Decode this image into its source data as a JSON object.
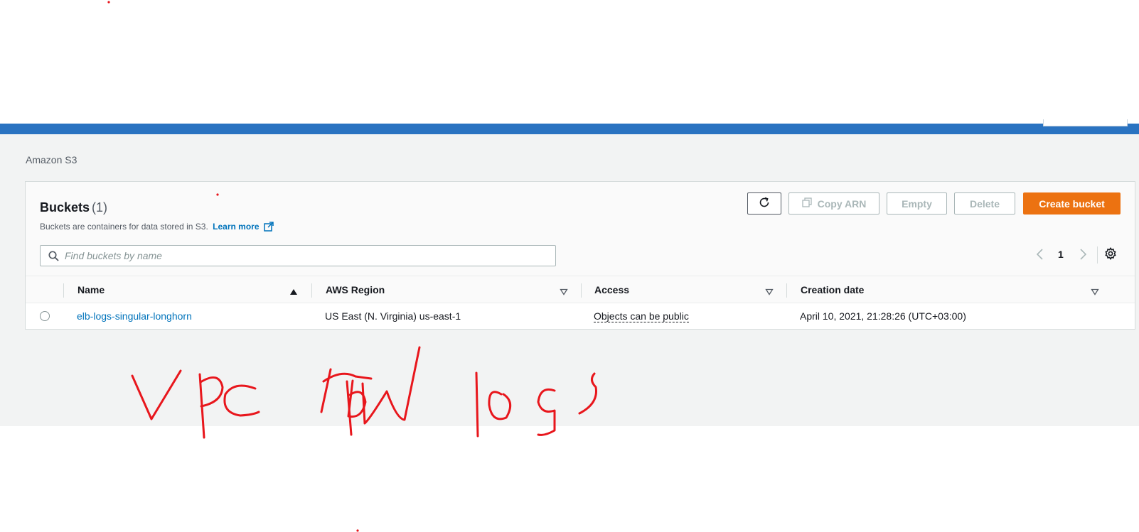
{
  "breadcrumb": "Amazon S3",
  "panel": {
    "title": "Buckets",
    "count": "(1)",
    "description": "Buckets are containers for data stored in S3.",
    "learn_more": "Learn more"
  },
  "actions": {
    "refresh_icon": "refresh-icon",
    "copy_arn": "Copy ARN",
    "empty": "Empty",
    "delete": "Delete",
    "create_bucket": "Create bucket"
  },
  "search": {
    "placeholder": "Find buckets by name",
    "value": ""
  },
  "pagination": {
    "current_page": "1"
  },
  "table": {
    "columns": [
      "Name",
      "AWS Region",
      "Access",
      "Creation date"
    ],
    "rows": [
      {
        "name": "elb-logs-singular-longhorn",
        "region": "US East (N. Virginia) us-east-1",
        "access": "Objects can be public",
        "creation_date": "April 10, 2021, 21:28:26 (UTC+03:00)"
      }
    ]
  },
  "annotation": {
    "handwritten_text": "Vpc flow logs",
    "color": "#e8161c"
  },
  "colors": {
    "header_bar": "#2a73c1",
    "primary_button": "#ec7211",
    "link": "#0073bb",
    "background": "#f2f3f3"
  }
}
